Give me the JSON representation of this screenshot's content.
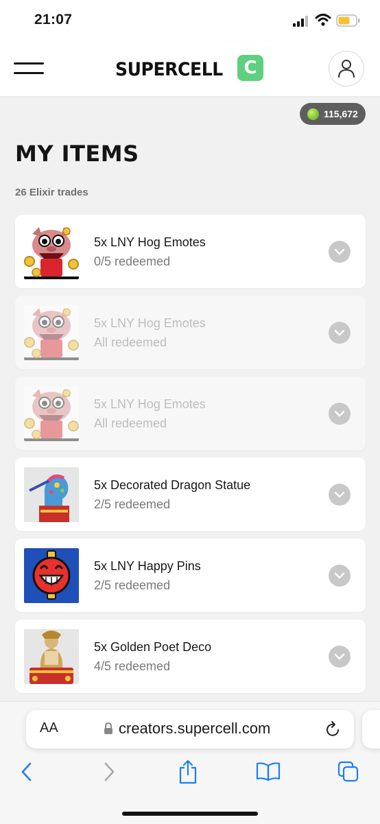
{
  "status_bar": {
    "time": "21:07"
  },
  "header": {
    "brand": "SUPERCELL",
    "brand_badge": "C"
  },
  "elixir": {
    "balance": "115,672",
    "color": "#8fd23f"
  },
  "page": {
    "title": "MY ITEMS",
    "subtitle": "26 Elixir trades"
  },
  "items": [
    {
      "name": "5x LNY Hog Emotes",
      "status": "0/5 redeemed",
      "redeemed_fraction": 0.0,
      "faded": false,
      "thumbnail": "hog-emote"
    },
    {
      "name": "5x LNY Hog Emotes",
      "status": "All redeemed",
      "redeemed_fraction": 1.0,
      "faded": true,
      "thumbnail": "hog-emote"
    },
    {
      "name": "5x LNY Hog Emotes",
      "status": "All redeemed",
      "redeemed_fraction": 1.0,
      "faded": true,
      "thumbnail": "hog-emote"
    },
    {
      "name": "5x Decorated Dragon Statue",
      "status": "2/5 redeemed",
      "redeemed_fraction": 0.4,
      "faded": false,
      "thumbnail": "dragon-statue"
    },
    {
      "name": "5x LNY Happy Pins",
      "status": "2/5 redeemed",
      "redeemed_fraction": 0.4,
      "faded": false,
      "thumbnail": "happy-lantern-pin"
    },
    {
      "name": "5x Golden Poet Deco",
      "status": "4/5 redeemed",
      "redeemed_fraction": 0.8,
      "faded": false,
      "thumbnail": "golden-poet"
    }
  ],
  "browser": {
    "aa_label": "AA",
    "url": "creators.supercell.com",
    "accent_color": "#1a7ef5"
  }
}
